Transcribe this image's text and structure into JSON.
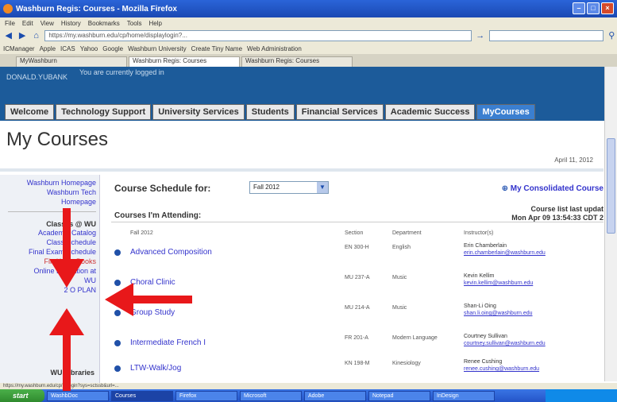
{
  "browser": {
    "window_title": "Washburn Regis: Courses - Mozilla Firefox",
    "menu": [
      "File",
      "Edit",
      "View",
      "History",
      "Bookmarks",
      "Tools",
      "Help"
    ],
    "url": "https://my.washburn.edu/cp/home/displaylogin?...",
    "bookmarks": [
      "ICManager",
      "Apple",
      "ICAS",
      "Yahoo",
      "Google",
      "Washburn University",
      "Create Tiny Name",
      "Web Administration"
    ],
    "tabs": [
      "MyWashburn",
      "Washburn Regis: Courses",
      "Washburn Regis: Courses"
    ]
  },
  "header": {
    "user": "DONALD.YUBANK",
    "unread": "You are currently logged in"
  },
  "site_tabs": [
    "Welcome",
    "Technology Support",
    "University Services",
    "Students",
    "Financial Services",
    "Academic Success",
    "MyCourses"
  ],
  "page": {
    "title": "My Courses",
    "date": "April 11, 2012"
  },
  "sidebar": {
    "links_top": [
      "Washburn Homepage",
      "Washburn Tech",
      "Homepage"
    ],
    "section_title": "Classes @ WU",
    "links": [
      "Academic Catalog",
      "Class Schedule",
      "Final Exam Schedule",
      "Find Your Books",
      "Online Education at",
      "WU",
      "2 O PLAN"
    ],
    "libraries": "WU Libraries"
  },
  "main": {
    "schedule_label": "Course Schedule for:",
    "term_selected": "Fall 2012",
    "consolidated": "My Consolidated Course",
    "attending_label": "Courses I'm Attending:",
    "last_updated_label": "Course list last updat",
    "last_updated_time": "Mon Apr 09 13:54:33 CDT 2",
    "col_heads": {
      "term": "Fall 2012",
      "section": "Section",
      "department": "Department",
      "instructor": "Instructor(s)"
    },
    "courses": [
      {
        "name": "Advanced Composition",
        "section": "EN 300-H",
        "dept": "English",
        "instructor": "Erin Chamberlain",
        "email": "erin.chamberlain@washburn.edu"
      },
      {
        "name": "Choral Clinic",
        "section": "MU 237-A",
        "dept": "Music",
        "instructor": "Kevin Kellim",
        "email": "kevin.kellim@washburn.edu"
      },
      {
        "name": "Group Study",
        "section": "MU 214-A",
        "dept": "Music",
        "instructor": "Shan-Li Oing",
        "email": "shan.li.oing@washburn.edu"
      },
      {
        "name": "Intermediate French I",
        "section": "FR 201-A",
        "dept": "Modern Language",
        "instructor": "Courtney Sullivan",
        "email": "courtney.sullivan@washburn.edu"
      },
      {
        "name": "LTW-Walk/Jog",
        "section": "KN 198-M",
        "dept": "Kinesiology",
        "instructor": "Renee Cushing",
        "email": "renee.cushing@washburn.edu"
      }
    ]
  },
  "statusbar": "https://my.washburn.edu/cp/ip/login?sys=sctssb&url=...",
  "taskbar": {
    "start": "start",
    "items": [
      "WashbDoc",
      "Courses",
      "Firefox",
      "Microsoft",
      "Adobe",
      "Notepad",
      "InDesign"
    ]
  },
  "colors": {
    "annotation_arrow": "#e8181a",
    "header_blue": "#1c5b9a",
    "link_blue": "#3333cc"
  }
}
